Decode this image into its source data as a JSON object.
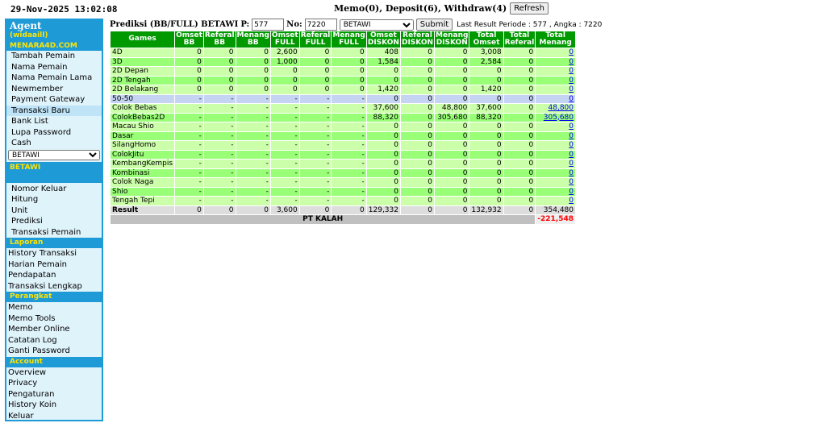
{
  "clock": "29-Nov-2025 13:02:08",
  "topbar": {
    "text": "Memo(0), Deposit(6), Withdraw(4)",
    "refresh_label": "Refresh"
  },
  "sidebar": {
    "agent_label": "Agent",
    "username": "(widaaill)",
    "site": "MENARA4D.COM",
    "menu": [
      {
        "label": "Tambah Pemain"
      },
      {
        "label": "Nama Pemain"
      },
      {
        "label": "Nama Pemain Lama"
      },
      {
        "label": "Newmember"
      },
      {
        "label": "Payment Gateway"
      },
      {
        "label": "Transaksi Baru"
      },
      {
        "label": "Bank List"
      },
      {
        "label": "Lupa Password"
      },
      {
        "label": "Cash"
      }
    ],
    "market_select_value": "BETAWI",
    "market_title": "BETAWI",
    "market_menu": [
      {
        "label": "Nomor Keluar"
      },
      {
        "label": "Hitung"
      },
      {
        "label": "Unit"
      },
      {
        "label": "Prediksi"
      },
      {
        "label": "Transaksi Pemain"
      }
    ],
    "laporan_title": "Laporan",
    "laporan_menu": [
      {
        "label": "History Transaksi"
      },
      {
        "label": "Harian Pemain"
      },
      {
        "label": "Pendapatan"
      },
      {
        "label": "Transaksi Lengkap"
      }
    ],
    "perangkat_title": "Perangkat",
    "perangkat_menu": [
      {
        "label": "Memo"
      },
      {
        "label": "Memo Tools"
      },
      {
        "label": "Member Online"
      },
      {
        "label": "Catatan Log"
      },
      {
        "label": "Ganti Password"
      }
    ],
    "account_title": "Account",
    "account_menu": [
      {
        "label": "Overview"
      },
      {
        "label": "Privacy"
      },
      {
        "label": "Pengaturan"
      },
      {
        "label": "History Koin"
      },
      {
        "label": "Keluar"
      }
    ]
  },
  "form": {
    "title": "Prediksi (BB/FULL) BETAWI",
    "p_label": "P:",
    "p_value": "577",
    "no_label": "No:",
    "no_value": "7220",
    "market_value": "BETAWI",
    "submit_label": "Submit",
    "info": "Last Result Periode : 577 , Angka : 7220"
  },
  "table": {
    "headers": [
      "Games",
      "Omset BB",
      "Referal BB",
      "Menang BB",
      "Omset FULL",
      "Referal FULL",
      "Menang FULL",
      "Omset DISKON",
      "Referal DISKON",
      "Menang DISKON",
      "Total Omset",
      "Total Referal",
      "Total Menang"
    ],
    "rows": [
      {
        "game": "4D",
        "cells": [
          "0",
          "0",
          "0",
          "2,600",
          "0",
          "0",
          "408",
          "0",
          "0",
          "3,008",
          "0"
        ],
        "menang": "0"
      },
      {
        "game": "3D",
        "cells": [
          "0",
          "0",
          "0",
          "1,000",
          "0",
          "0",
          "1,584",
          "0",
          "0",
          "2,584",
          "0"
        ],
        "menang": "0"
      },
      {
        "game": "2D Depan",
        "cells": [
          "0",
          "0",
          "0",
          "0",
          "0",
          "0",
          "0",
          "0",
          "0",
          "0",
          "0"
        ],
        "menang": "0"
      },
      {
        "game": "2D Tengah",
        "cells": [
          "0",
          "0",
          "0",
          "0",
          "0",
          "0",
          "0",
          "0",
          "0",
          "0",
          "0"
        ],
        "menang": "0"
      },
      {
        "game": "2D Belakang",
        "cells": [
          "0",
          "0",
          "0",
          "0",
          "0",
          "0",
          "1,420",
          "0",
          "0",
          "1,420",
          "0"
        ],
        "menang": "0"
      },
      {
        "game": "50-50",
        "cells": [
          "-",
          "-",
          "-",
          "-",
          "-",
          "-",
          "0",
          "0",
          "0",
          "0",
          "0"
        ],
        "menang": "0"
      },
      {
        "game": "Colok Bebas",
        "cells": [
          "-",
          "-",
          "-",
          "-",
          "-",
          "-",
          "37,600",
          "0",
          "48,800",
          "37,600",
          "0"
        ],
        "menang": "48,800"
      },
      {
        "game": "ColokBebas2D",
        "cells": [
          "-",
          "-",
          "-",
          "-",
          "-",
          "-",
          "88,320",
          "0",
          "305,680",
          "88,320",
          "0"
        ],
        "menang": "305,680"
      },
      {
        "game": "Macau Shio",
        "cells": [
          "-",
          "-",
          "-",
          "-",
          "-",
          "-",
          "0",
          "0",
          "0",
          "0",
          "0"
        ],
        "menang": "0"
      },
      {
        "game": "Dasar",
        "cells": [
          "-",
          "-",
          "-",
          "-",
          "-",
          "-",
          "0",
          "0",
          "0",
          "0",
          "0"
        ],
        "menang": "0"
      },
      {
        "game": "SilangHomo",
        "cells": [
          "-",
          "-",
          "-",
          "-",
          "-",
          "-",
          "0",
          "0",
          "0",
          "0",
          "0"
        ],
        "menang": "0"
      },
      {
        "game": "ColokJitu",
        "cells": [
          "-",
          "-",
          "-",
          "-",
          "-",
          "-",
          "0",
          "0",
          "0",
          "0",
          "0"
        ],
        "menang": "0"
      },
      {
        "game": "KembangKempis",
        "cells": [
          "-",
          "-",
          "-",
          "-",
          "-",
          "-",
          "0",
          "0",
          "0",
          "0",
          "0"
        ],
        "menang": "0"
      },
      {
        "game": "Kombinasi",
        "cells": [
          "-",
          "-",
          "-",
          "-",
          "-",
          "-",
          "0",
          "0",
          "0",
          "0",
          "0"
        ],
        "menang": "0"
      },
      {
        "game": "Colok Naga",
        "cells": [
          "-",
          "-",
          "-",
          "-",
          "-",
          "-",
          "0",
          "0",
          "0",
          "0",
          "0"
        ],
        "menang": "0"
      },
      {
        "game": "Shio",
        "cells": [
          "-",
          "-",
          "-",
          "-",
          "-",
          "-",
          "0",
          "0",
          "0",
          "0",
          "0"
        ],
        "menang": "0"
      },
      {
        "game": "Tengah Tepi",
        "cells": [
          "-",
          "-",
          "-",
          "-",
          "-",
          "-",
          "0",
          "0",
          "0",
          "0",
          "0"
        ],
        "menang": "0"
      }
    ],
    "result": {
      "label": "Result",
      "cells": [
        "0",
        "0",
        "0",
        "3,600",
        "0",
        "0",
        "129,332",
        "0",
        "0",
        "132,932",
        "0",
        "354,480"
      ]
    },
    "pt": {
      "label": "PT KALAH",
      "value": "-221,548"
    }
  }
}
